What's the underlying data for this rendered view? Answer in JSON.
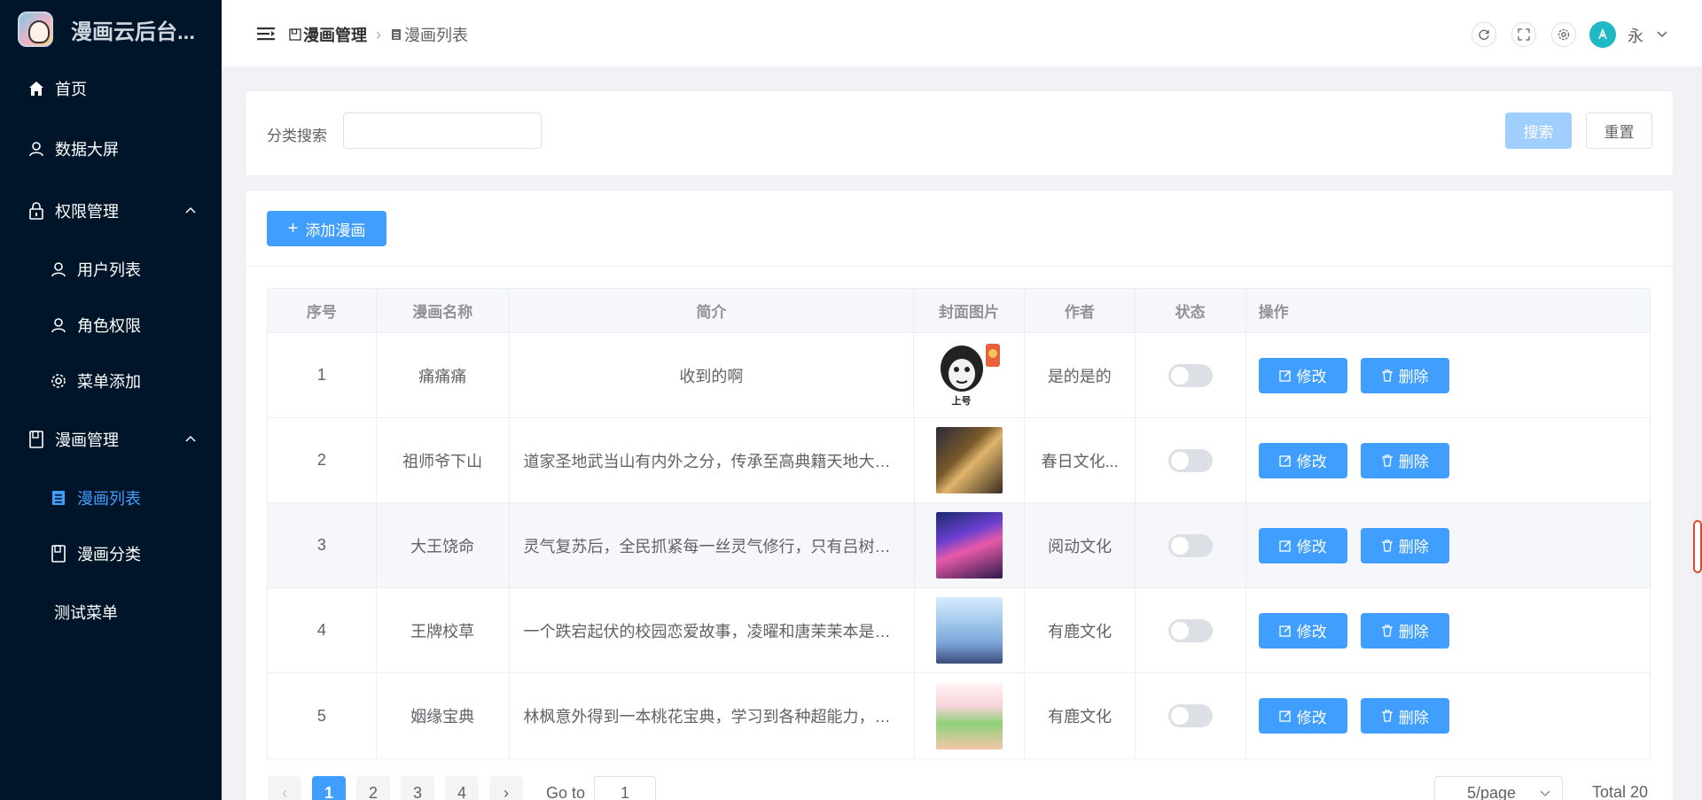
{
  "app": {
    "title": "漫画云后台..."
  },
  "sidebar": {
    "items": [
      {
        "label": "首页",
        "icon": "home-icon"
      },
      {
        "label": "数据大屏",
        "icon": "user-icon"
      },
      {
        "label": "权限管理",
        "icon": "lock-icon"
      },
      {
        "label": "用户列表",
        "icon": "user-icon"
      },
      {
        "label": "角色权限",
        "icon": "user-icon"
      },
      {
        "label": "菜单添加",
        "icon": "gear-icon"
      },
      {
        "label": "漫画管理",
        "icon": "book-icon"
      },
      {
        "label": "漫画列表",
        "icon": "list-icon"
      },
      {
        "label": "漫画分类",
        "icon": "book-icon"
      },
      {
        "label": "测试菜单",
        "icon": ""
      }
    ]
  },
  "header": {
    "breadcrumb": [
      "漫画管理",
      "漫画列表"
    ],
    "username": "永"
  },
  "search": {
    "label": "分类搜索",
    "value": "",
    "placeholder": "",
    "search_label": "搜索",
    "reset_label": "重置"
  },
  "toolbar": {
    "add_label": "添加漫画"
  },
  "table": {
    "headers": [
      "序号",
      "漫画名称",
      "简介",
      "封面图片",
      "作者",
      "状态",
      "操作"
    ],
    "rows": [
      {
        "no": "1",
        "name": "痛痛痛",
        "desc": "收到的啊",
        "author": "是的是的"
      },
      {
        "no": "2",
        "name": "祖师爷下山",
        "desc": "道家圣地武当山有内外之分，传承至高典籍天地大道...",
        "author": "春日文化..."
      },
      {
        "no": "3",
        "name": "大王饶命",
        "desc": "灵气复苏后，全民抓紧每一丝灵气修行，只有吕树，...",
        "author": "阅动文化"
      },
      {
        "no": "4",
        "name": "王牌校草",
        "desc": "一个跌宕起伏的校园恋爱故事，凌曜和唐茉茉本是命...",
        "author": "有鹿文化"
      },
      {
        "no": "5",
        "name": "姻缘宝典",
        "desc": "林枫意外得到一本桃花宝典，学习到各种超能力，从...",
        "author": "有鹿文化"
      }
    ],
    "cover_text_1": "上号",
    "edit_label": "修改",
    "delete_label": "删除"
  },
  "pagination": {
    "pages": [
      "1",
      "2",
      "3",
      "4"
    ],
    "current": "1",
    "goto_label": "Go to",
    "goto_value": "1",
    "page_size": "5/page",
    "total": "Total 20"
  },
  "colors": {
    "primary": "#409eff",
    "sidebar": "#001529",
    "disabled": "#a0cfff"
  }
}
